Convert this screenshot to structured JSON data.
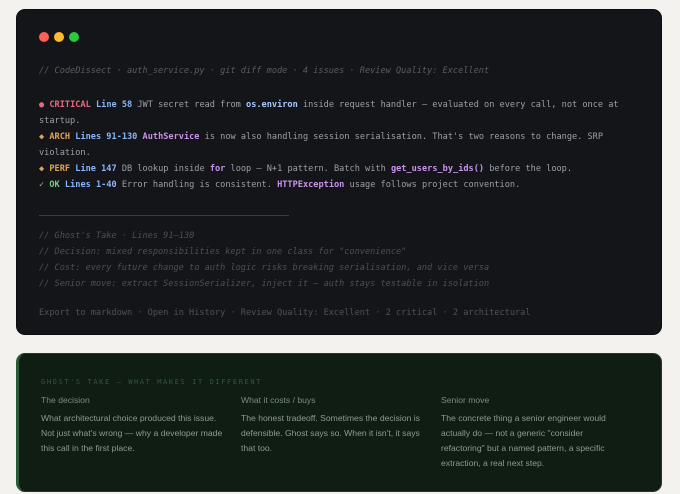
{
  "terminal": {
    "header": "// CodeDissect · auth_service.py · git diff mode · 4 issues · Review Quality: Excellent",
    "issues": [
      {
        "icon": "●",
        "severity": "CRITICAL",
        "lines": "Line 58",
        "text_a": "JWT secret read from ",
        "code_a": "os.environ",
        "text_b": " inside request handler — evaluated on every call, not once at startup."
      },
      {
        "icon": "◆",
        "severity": "ARCH",
        "lines": "Lines 91-130",
        "code_a": "AuthService",
        "text_b": " is now also handling session serialisation. That's two reasons to change. SRP violation."
      },
      {
        "icon": "◆",
        "severity": "PERF",
        "lines": "Line 147",
        "text_a": "DB lookup inside ",
        "kw": "for",
        "text_b": " loop — N+1 pattern. Batch with ",
        "code_a": "get_users_by_ids()",
        "text_c": " before the loop."
      },
      {
        "icon": "✓",
        "severity": "OK",
        "lines": "Lines 1-40",
        "text_a": "Error handling is consistent. ",
        "code_a": "HTTPException",
        "text_b": " usage follows project convention."
      }
    ],
    "ghost_lines": [
      "// Ghost's Take · Lines 91–130",
      "// Decision: mixed responsibilities kept in one class for \"convenience\"",
      "// Cost: every future change to auth logic risks breaking serialisation, and vice versa",
      "// Senior move: extract SessionSerializer, inject it — auth stays testable in isolation"
    ],
    "footer": "Export to markdown · Open in History · Review Quality: Excellent · 2 critical · 2 architectural"
  },
  "panel": {
    "title": "GHOST'S TAKE — WHAT MAKES IT DIFFERENT",
    "columns": [
      {
        "heading": "The decision",
        "body": "What architectural choice produced this issue. Not just what's wrong — why a developer made this call in the first place."
      },
      {
        "heading": "What it costs / buys",
        "body": "The honest tradeoff. Sometimes the decision is defensible. Ghost says so. When it isn't, it says that too."
      },
      {
        "heading": "Senior move",
        "body": "The concrete thing a senior engineer would actually do — not a generic \"consider refactoring\" but a named pattern, a specific extraction, a real next step."
      }
    ]
  },
  "colors": {
    "terminal_bg": "#141519",
    "panel_bg": "#0f1d13",
    "critical": "#e86a80",
    "warning": "#e0a458",
    "ok": "#6fcf7f",
    "window_red": "#ff5f57",
    "window_yellow": "#febc2e",
    "window_green": "#28c840"
  }
}
